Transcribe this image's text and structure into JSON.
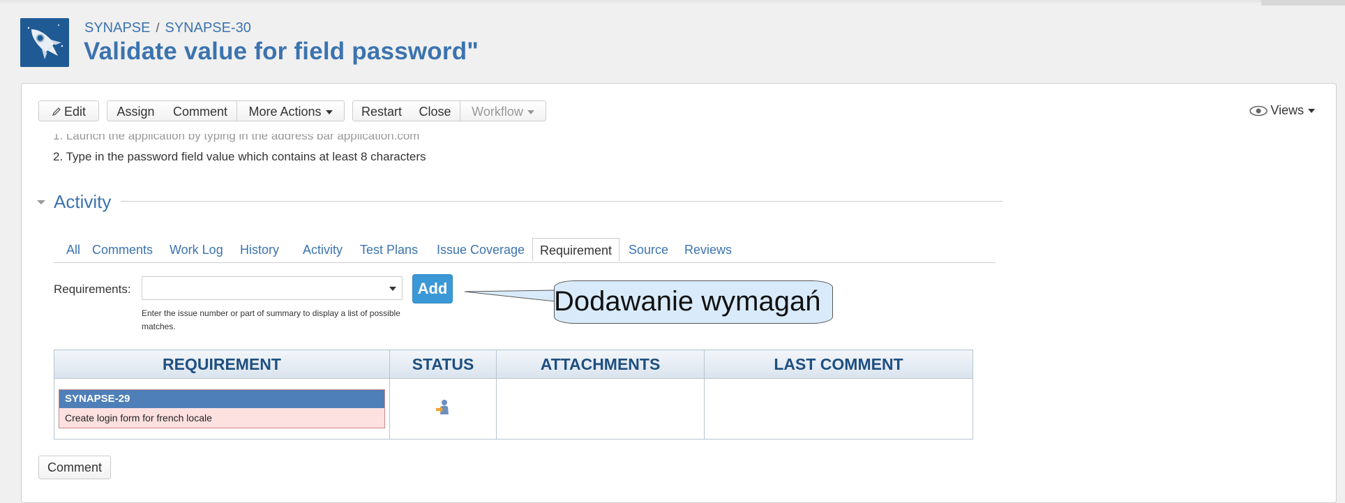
{
  "header": {
    "project": "SYNAPSE",
    "separator": "/",
    "issue_key": "SYNAPSE-30",
    "title": "Validate value for field password\""
  },
  "toolbar": {
    "edit": "Edit",
    "assign": "Assign",
    "comment": "Comment",
    "more_actions": "More Actions",
    "restart": "Restart",
    "close": "Close",
    "workflow": "Workflow",
    "views": "Views"
  },
  "description": {
    "line1": "1. Launch the application by typing in the address bar application.com",
    "line2": "2. Type in the password field value which contains at least 8 characters"
  },
  "activity": {
    "title": "Activity",
    "tabs": [
      "All",
      "Comments",
      "Work Log",
      "History",
      "Activity",
      "Test Plans",
      "Issue Coverage",
      "Requirement",
      "Source",
      "Reviews"
    ],
    "active_tab": "Requirement"
  },
  "requirements": {
    "label": "Requirements:",
    "selected_value": "",
    "add_label": "Add",
    "hint": "Enter the issue number or part of summary to display a list of possible matches."
  },
  "callout": {
    "text": "Dodawanie wymagań"
  },
  "table": {
    "headers": [
      "REQUIREMENT",
      "STATUS",
      "ATTACHMENTS",
      "LAST COMMENT"
    ],
    "rows": [
      {
        "key": "SYNAPSE-29",
        "summary": "Create login form for french locale",
        "status_icon": "user-status-icon",
        "attachments": "",
        "last_comment": ""
      }
    ]
  },
  "footer": {
    "comment_button": "Comment"
  },
  "colors": {
    "link": "#3b73af",
    "add_button": "#3b98d6",
    "req_key_bg": "#4f7fb8",
    "req_summary_bg": "#fde0e0"
  }
}
